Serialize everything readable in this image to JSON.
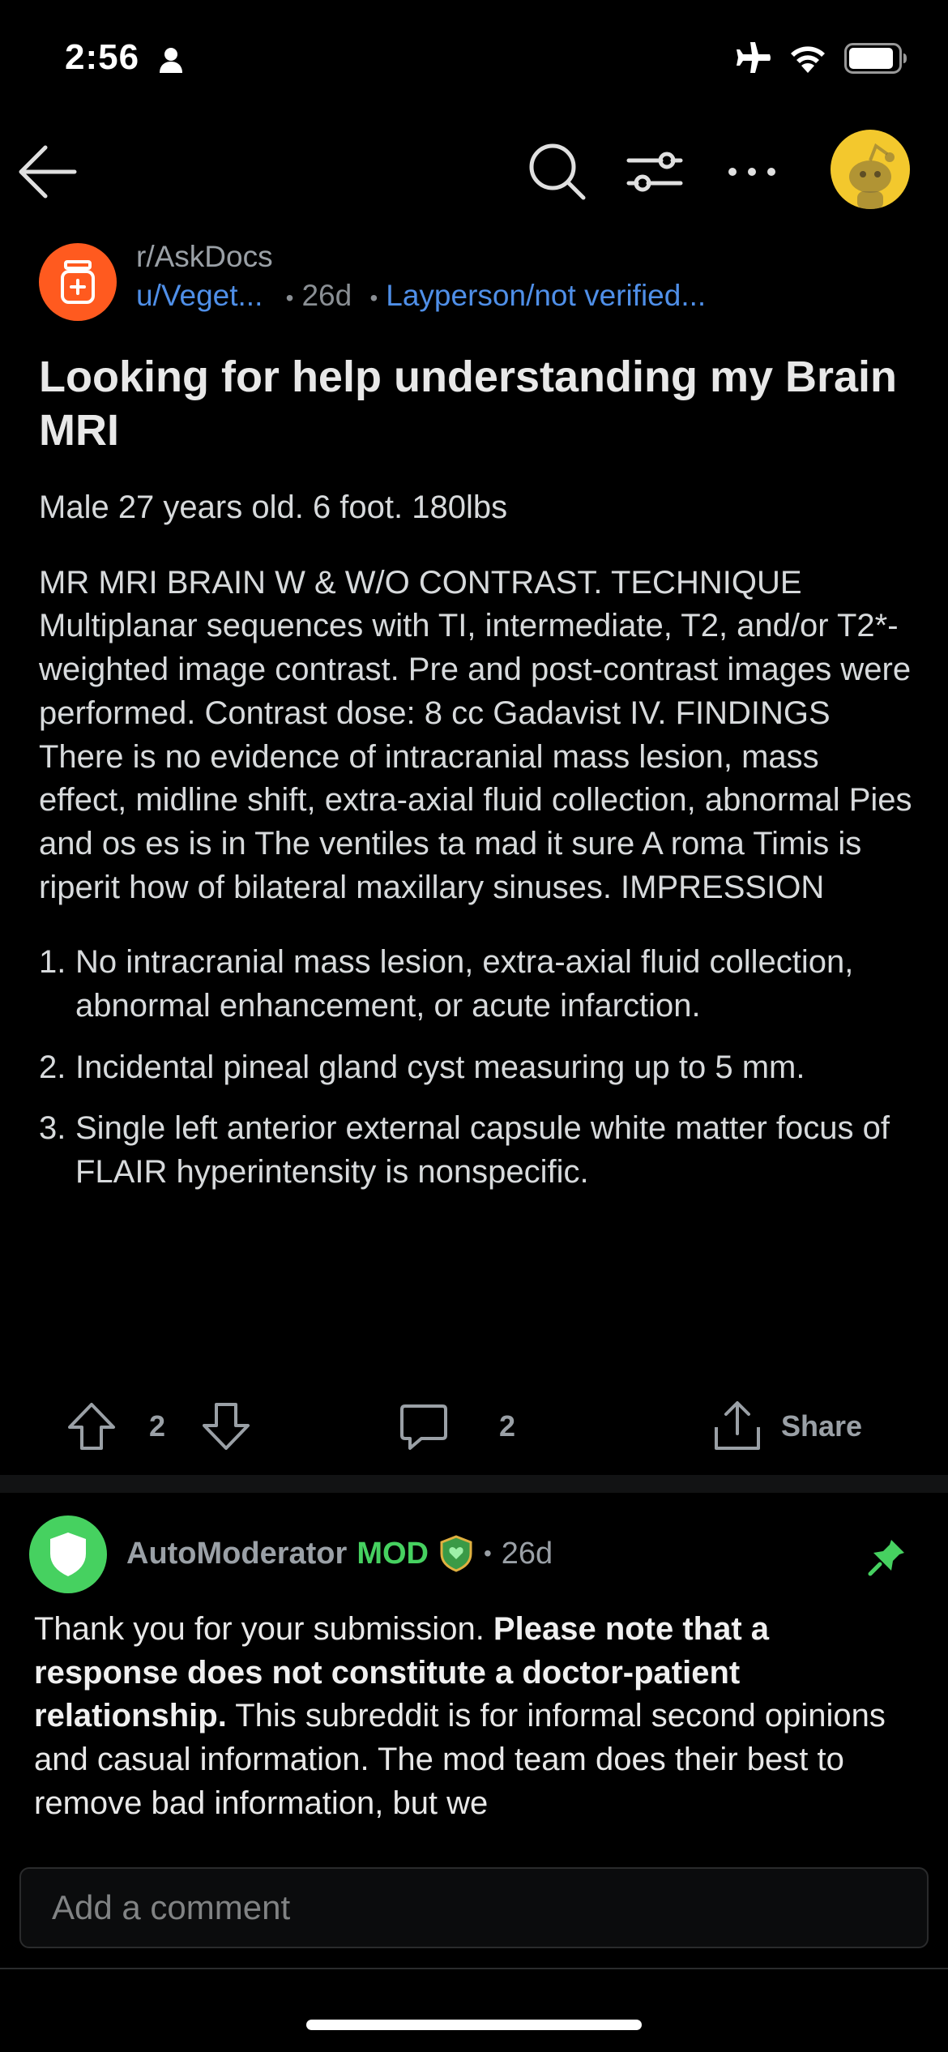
{
  "status_bar": {
    "time": "2:56"
  },
  "post": {
    "subreddit": "r/AskDocs",
    "author": "u/Veget...",
    "age": "26d",
    "separator": "•",
    "flair": "Layperson/not verified...",
    "title": "Looking for help understanding my Brain MRI",
    "body_paragraphs": [
      "Male 27 years old. 6 foot. 180lbs",
      "MR MRI BRAIN W & W/O CONTRAST. TECHNIQUE Multiplanar sequences with TI, intermediate, T2, and/or T2*-weighted image contrast. Pre and post-contrast images were performed. Contrast dose: 8 cc Gadavist IV. FINDINGS There is no evidence of intracranial mass lesion, mass effect, midline shift, extra-axial fluid collection, abnormal Pies and os es is in The ventiles ta mad it sure A roma Timis is riperit how of bilateral maxillary sinuses. IMPRESSION"
    ],
    "list_items": [
      {
        "num": "1.",
        "text": "No intracranial mass lesion, extra-axial fluid collection, abnormal enhancement, or acute infarction."
      },
      {
        "num": "2.",
        "text": "Incidental pineal gland cyst measuring up to 5 mm."
      },
      {
        "num": "3.",
        "text": "Single left anterior external capsule white matter focus of FLAIR hyperintensity is nonspecific."
      }
    ],
    "vote_count": "2",
    "comment_count": "2",
    "share_label": "Share"
  },
  "comment": {
    "author": "AutoModerator",
    "mod_label": "MOD",
    "separator": "•",
    "age": "26d",
    "text_start": "Thank you for your submission. ",
    "text_bold": "Please note that a response does not constitute a doctor-patient relationship.",
    "text_end": " This subreddit is for informal second opinions and casual information. The mod team does their best to remove bad information, but we"
  },
  "comment_input": {
    "placeholder": "Add a comment"
  },
  "colors": {
    "subreddit_icon": "#ff5a1f",
    "automod_avatar": "#46d160",
    "link_blue": "#4f8fe8",
    "mod_green": "#46d160",
    "nav_avatar": "#f3c82d"
  }
}
